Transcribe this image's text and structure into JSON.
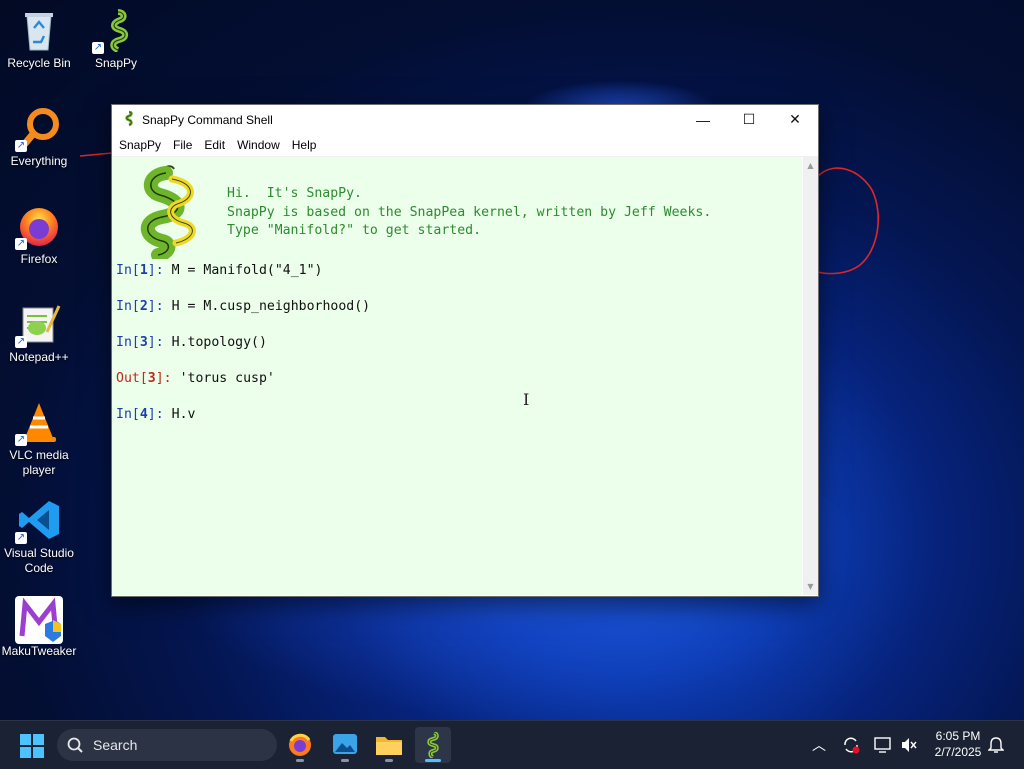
{
  "desktop": {
    "icons": [
      {
        "label": "Recycle Bin",
        "icon": "recycle-bin-icon"
      },
      {
        "label": "SnapPy",
        "icon": "snappy-icon"
      },
      {
        "label": "Everything",
        "icon": "everything-icon"
      },
      {
        "label": "Firefox",
        "icon": "firefox-icon"
      },
      {
        "label": "Notepad++",
        "icon": "notepadpp-icon"
      },
      {
        "label": "VLC media player",
        "icon": "vlc-icon"
      },
      {
        "label": "Visual Studio Code",
        "icon": "vscode-icon"
      },
      {
        "label": "MakuTweaker",
        "icon": "makutweaker-icon"
      }
    ]
  },
  "window": {
    "title": "SnapPy Command Shell",
    "controls": {
      "minimize": "—",
      "maximize": "☐",
      "close": "✕"
    },
    "menu": [
      "SnapPy",
      "File",
      "Edit",
      "Window",
      "Help"
    ]
  },
  "console": {
    "banner": [
      "Hi.  It's SnapPy.",
      "SnapPy is based on the SnapPea kernel, written by Jeff Weeks.",
      "Type \"Manifold?\" to get started."
    ],
    "lines": [
      {
        "prompt": "In",
        "num": "1",
        "code": "M = Manifold(\"4_1\")"
      },
      {
        "prompt": "In",
        "num": "2",
        "code": "H = M.cusp_neighborhood()"
      },
      {
        "prompt": "In",
        "num": "3",
        "code": "H.topology()"
      },
      {
        "prompt": "Out",
        "num": "3",
        "code": "'torus cusp'"
      },
      {
        "prompt": "In",
        "num": "4",
        "code": "H.v"
      }
    ]
  },
  "taskbar": {
    "search_label": "Search",
    "apps": [
      "firefox-icon",
      "photos-icon",
      "file-explorer-icon",
      "snappy-icon"
    ],
    "active_app": "snappy-icon",
    "time": "6:05 PM",
    "date": "2/7/2025"
  },
  "colors": {
    "console_bg": "#ebffeb",
    "banner_text": "#2f8a2f",
    "in_prompt": "#1d3fa8",
    "out_prompt": "#c0281b",
    "accent": "#4cc2ff"
  }
}
